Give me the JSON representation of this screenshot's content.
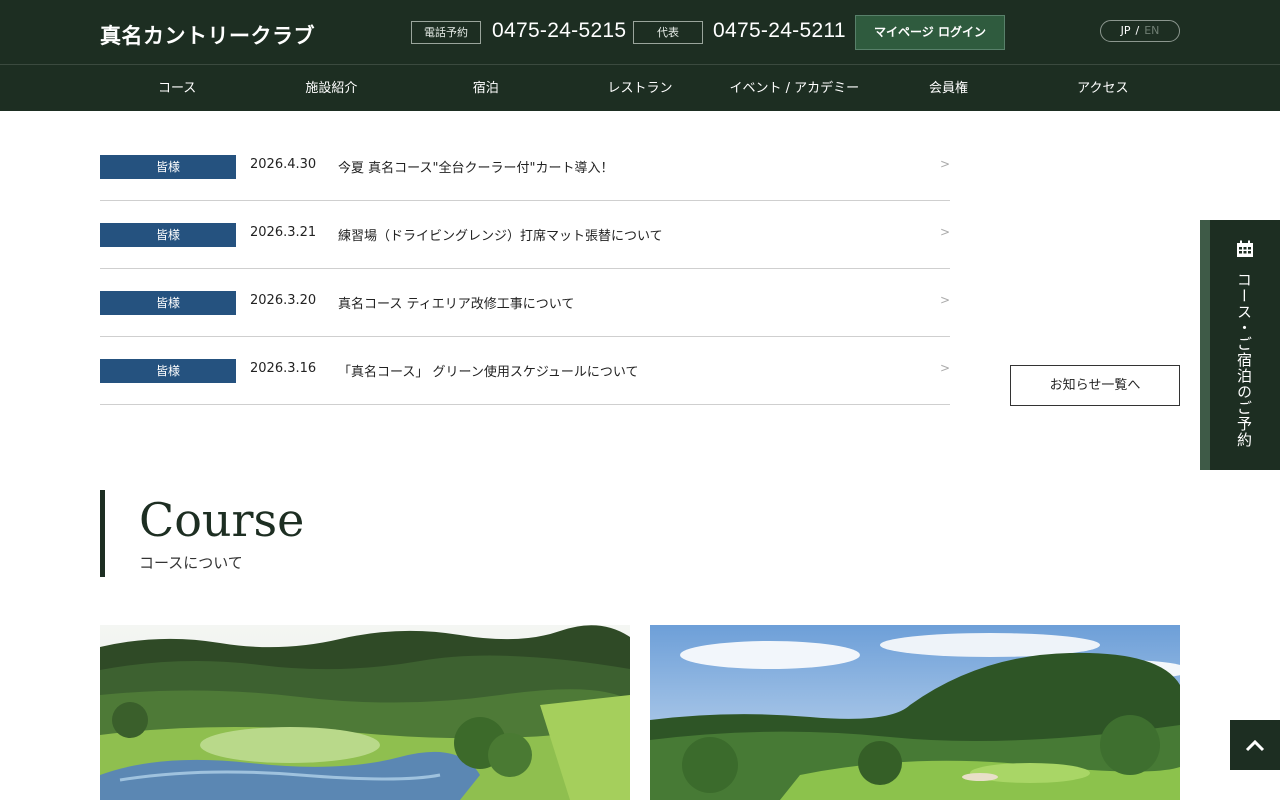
{
  "header": {
    "logo": "真名カントリークラブ",
    "reservation_tag": "電話予約",
    "reservation_phone": "0475-24-5215",
    "main_tag": "代表",
    "main_phone": "0475-24-5211",
    "login_label": "マイページ ログイン",
    "lang_jp": "JP",
    "lang_sep": "/",
    "lang_en": "EN"
  },
  "nav": {
    "items": [
      {
        "label": "コース"
      },
      {
        "label": "施設紹介"
      },
      {
        "label": "宿泊"
      },
      {
        "label": "レストラン"
      },
      {
        "label": "イベント / アカデミー"
      },
      {
        "label": "会員権"
      },
      {
        "label": "アクセス"
      }
    ]
  },
  "news": {
    "items": [
      {
        "badge": "皆様",
        "date": "2026.4.30",
        "title": "今夏 真名コース\"全台クーラー付\"カート導入！"
      },
      {
        "badge": "皆様",
        "date": "2026.3.21",
        "title": "練習場（ドライビングレンジ）打席マット張替について"
      },
      {
        "badge": "皆様",
        "date": "2026.3.20",
        "title": "真名コース ティエリア改修工事について"
      },
      {
        "badge": "皆様",
        "date": "2026.3.16",
        "title": "「真名コース」 グリーン使用スケジュールについて"
      }
    ],
    "arrow": ">",
    "all_label": "お知らせ一覧へ"
  },
  "side_tab": {
    "label": "コース・ご宿泊のご予約"
  },
  "course": {
    "title": "Course",
    "subtitle": "コースについて"
  },
  "colors": {
    "header_bg": "#1d2e22",
    "badge_bg": "#25527f",
    "accent_green": "#2f5b3e"
  }
}
